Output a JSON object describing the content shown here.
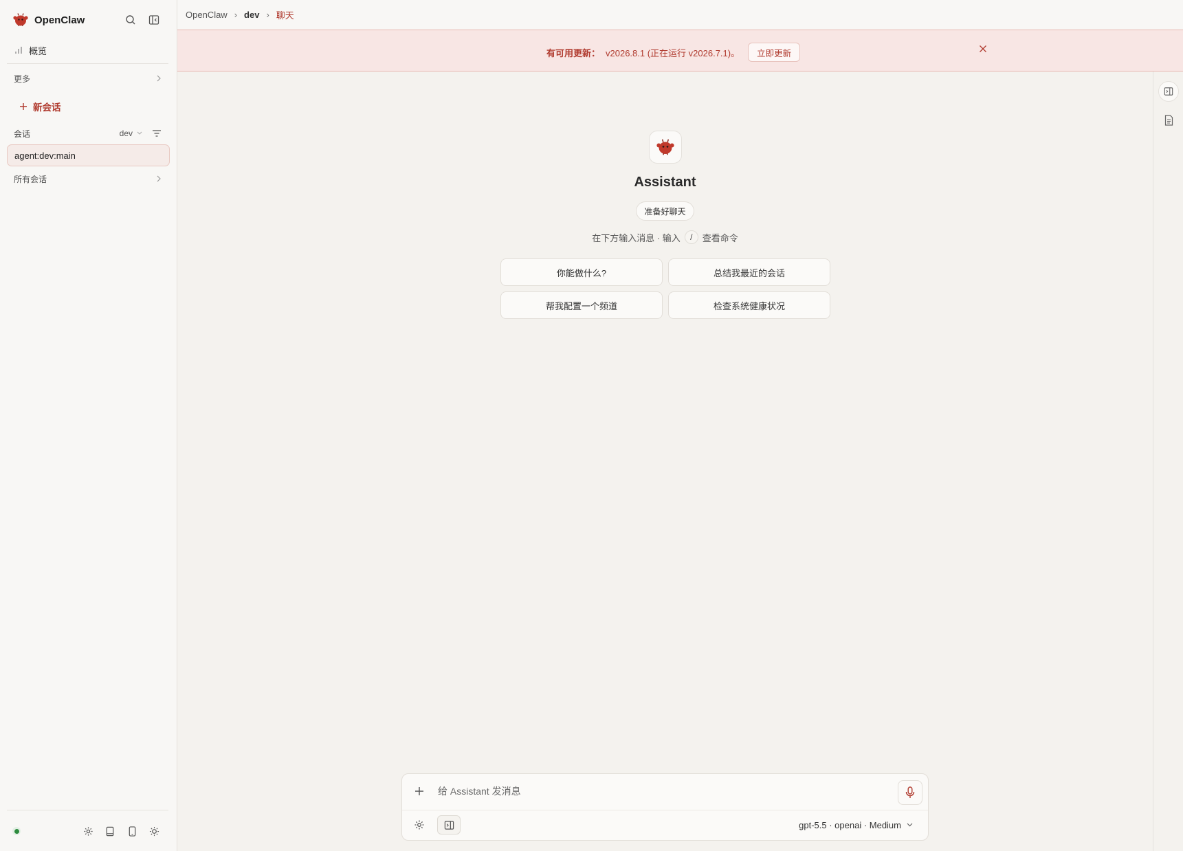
{
  "app": {
    "name": "OpenClaw"
  },
  "sidebar": {
    "overview_label": "概览",
    "more_label": "更多",
    "new_chat_label": "新会话",
    "sessions_label": "会话",
    "agent_filter_value": "dev",
    "active_session": "agent:dev:main",
    "all_sessions_label": "所有会话"
  },
  "breadcrumb": {
    "root": "OpenClaw",
    "agent": "dev",
    "page": "聊天"
  },
  "banner": {
    "title": "有可用更新：",
    "message": "v2026.8.1 (正在运行 v2026.7.1)。",
    "update_button": "立即更新"
  },
  "welcome": {
    "assistant_name": "Assistant",
    "status_pill": "准备好聊天",
    "hint_before": "在下方输入消息 · 输入",
    "hint_key": "/",
    "hint_after": "查看命令",
    "suggestions": [
      "你能做什么?",
      "总结我最近的会话",
      "帮我配置一个频道",
      "检查系统健康状况"
    ]
  },
  "composer": {
    "placeholder": "给 Assistant 发消息",
    "model_label": "gpt-5.5 · openai · Medium"
  },
  "colors": {
    "accent": "#b03a2e",
    "banner_bg": "#f8e6e4",
    "background": "#f4f2ee",
    "status_online": "#2e8b3e"
  },
  "icons": {
    "brand": "lobster-logo-icon",
    "search": "search-icon",
    "collapse": "sidebar-collapse-icon",
    "overview": "bar-chart-icon",
    "filter": "filter-icon",
    "settings": "gear-icon",
    "docs": "book-icon",
    "mobile": "phone-icon",
    "theme": "sun-icon",
    "mic": "microphone-icon",
    "close": "close-icon"
  }
}
